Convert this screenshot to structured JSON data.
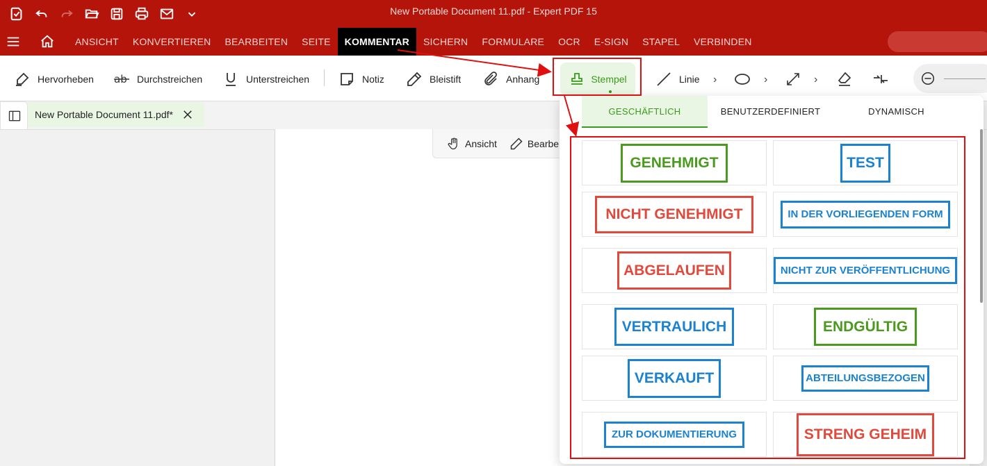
{
  "window": {
    "title": "New Portable Document 11.pdf   -   Expert PDF 15"
  },
  "quick_access": [
    "app-logo-icon",
    "undo-icon",
    "redo-icon",
    "open-folder-icon",
    "save-icon",
    "print-icon",
    "mail-icon",
    "chevron-down-icon"
  ],
  "menu": {
    "items": [
      "ANSICHT",
      "KONVERTIEREN",
      "BEARBEITEN",
      "SEITE",
      "KOMMENTAR",
      "SICHERN",
      "FORMULARE",
      "OCR",
      "E-SIGN",
      "STAPEL",
      "VERBINDEN"
    ],
    "active": "KOMMENTAR"
  },
  "ribbon": {
    "highlight": "Hervorheben",
    "strikethrough": "Durchstreichen",
    "underline": "Unterstreichen",
    "note": "Notiz",
    "pencil": "Bleistift",
    "attachment": "Anhang",
    "stamp": "Stempel",
    "line": "Linie"
  },
  "doc_tab": {
    "label": "New Portable Document 11.pdf*"
  },
  "view_tools": {
    "view": "Ansicht",
    "edit": "Bearbei"
  },
  "stamp_panel": {
    "tabs": [
      "GESCHÄFTLICH",
      "BENUTZERDEFINIERT",
      "DYNAMISCH"
    ],
    "active_tab": "GESCHÄFTLICH",
    "stamps": [
      {
        "text": "GENEHMIGT",
        "color": "#4a9a1e"
      },
      {
        "text": "TEST",
        "color": "#1a82d1"
      },
      {
        "text": "NICHT GENEHMIGT",
        "color": "#e0493b"
      },
      {
        "text": "IN DER VORLIEGENDEN FORM",
        "color": "#1a82d1"
      },
      {
        "text": "ABGELAUFEN",
        "color": "#e0493b"
      },
      {
        "text": "NICHT ZUR VERÖFFENTLICHUNG",
        "color": "#1a82d1"
      },
      {
        "text": "VERTRAULICH",
        "color": "#1a82d1"
      },
      {
        "text": "ENDGÜLTIG",
        "color": "#4a9a1e"
      },
      {
        "text": "VERKAUFT",
        "color": "#1a82d1"
      },
      {
        "text": "ABTEILUNGSBEZOGEN",
        "color": "#1a82d1"
      },
      {
        "text": "ZUR DOKUMENTIERUNG",
        "color": "#1a82d1"
      },
      {
        "text": "STRENG GEHEIM",
        "color": "#e0493b"
      }
    ]
  },
  "colors": {
    "brand_red": "#b5140b",
    "accent_green": "#3a9a1c",
    "annotation_red": "#e01010"
  }
}
